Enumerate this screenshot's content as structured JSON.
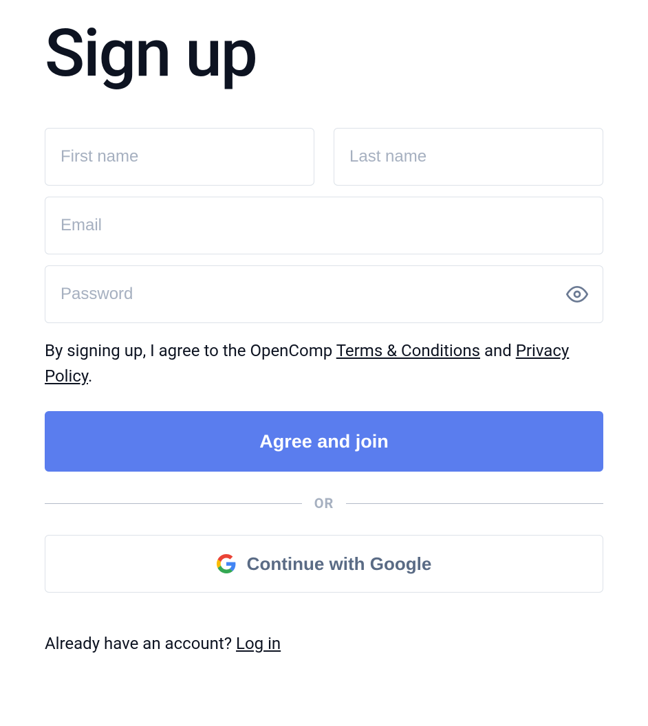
{
  "title": "Sign up",
  "fields": {
    "first_name": {
      "placeholder": "First name",
      "value": ""
    },
    "last_name": {
      "placeholder": "Last name",
      "value": ""
    },
    "email": {
      "placeholder": "Email",
      "value": ""
    },
    "password": {
      "placeholder": "Password",
      "value": ""
    }
  },
  "terms": {
    "prefix": "By signing up, I agree to the OpenComp ",
    "terms_link": "Terms & Conditions",
    "middle": " and ",
    "privacy_link": "Privacy Policy",
    "suffix": "."
  },
  "buttons": {
    "primary": "Agree and join",
    "google": "Continue with Google"
  },
  "divider": "OR",
  "login_prompt": {
    "text": "Already have an account? ",
    "link": "Log in"
  }
}
